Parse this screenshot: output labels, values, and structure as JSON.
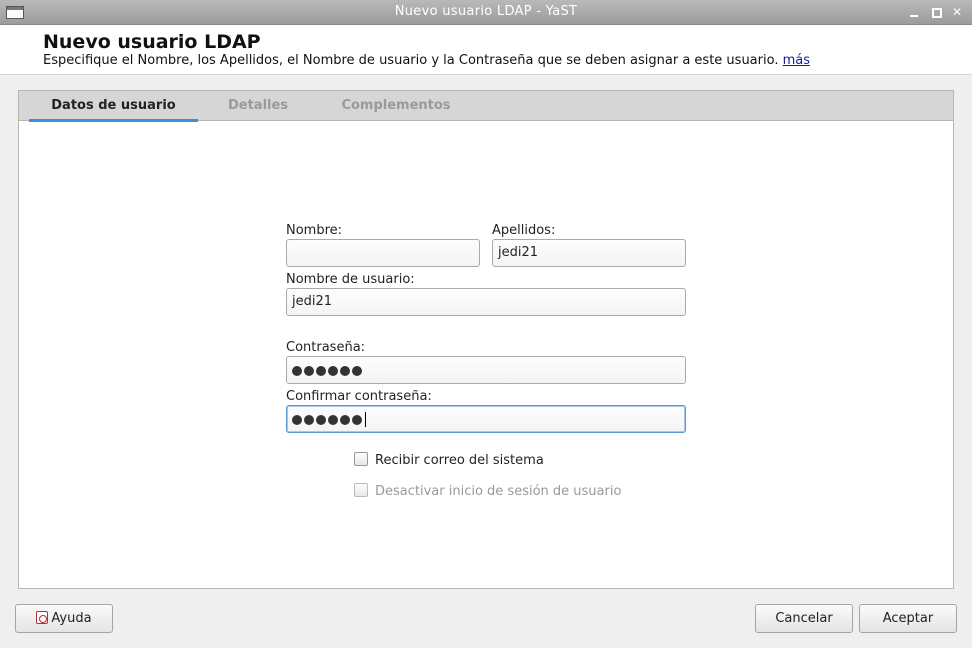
{
  "window": {
    "title": "Nuevo usuario LDAP - YaST"
  },
  "header": {
    "title": "Nuevo usuario LDAP",
    "description": "Especifique el Nombre, los Apellidos, el Nombre de usuario y la Contraseña que se deben asignar a este usuario.",
    "more_link": "más"
  },
  "tabs": [
    {
      "label": "Datos de usuario",
      "active": true
    },
    {
      "label": "Detalles",
      "active": false
    },
    {
      "label": "Complementos",
      "active": false
    }
  ],
  "form": {
    "first_name": {
      "label": "Nombre:",
      "value": ""
    },
    "last_name": {
      "label": "Apellidos:",
      "value": "jedi21"
    },
    "username": {
      "label": "Nombre de usuario:",
      "value": "jedi21"
    },
    "password": {
      "label": "Contraseña:",
      "masked_length": 6
    },
    "confirm_password": {
      "label": "Confirmar contraseña:",
      "masked_length": 6
    },
    "receive_system_mail": {
      "label": "Recibir correo del sistema",
      "checked": false
    },
    "disable_login": {
      "label": "Desactivar inicio de sesión de usuario",
      "checked": false,
      "enabled": false
    }
  },
  "buttons": {
    "help": "Ayuda",
    "cancel": "Cancelar",
    "accept": "Aceptar"
  },
  "colors": {
    "active_tab_underline": "#3d8ee0",
    "link": "#1a1aa6",
    "titlebar": "#a8a8a8"
  }
}
